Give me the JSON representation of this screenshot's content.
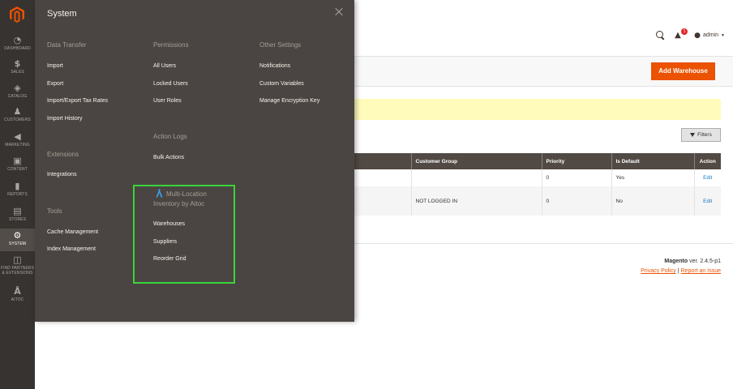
{
  "colors": {
    "sidebar_bg": "#373330",
    "flyout_bg": "#4a4542",
    "accent": "#eb5202",
    "highlight_border": "#39d53a",
    "grid_header": "#514943",
    "notice_bg": "#fffbbb",
    "link": "#1979c3"
  },
  "sidebar": {
    "logo_icon": "magento-logo-icon",
    "items": [
      {
        "label": "DASHBOARD",
        "icon": "speedometer-icon"
      },
      {
        "label": "SALES",
        "icon": "dollar-icon"
      },
      {
        "label": "CATALOG",
        "icon": "cube-icon"
      },
      {
        "label": "CUSTOMERS",
        "icon": "person-icon"
      },
      {
        "label": "MARKETING",
        "icon": "megaphone-icon"
      },
      {
        "label": "CONTENT",
        "icon": "layout-icon"
      },
      {
        "label": "REPORTS",
        "icon": "bar-chart-icon"
      },
      {
        "label": "STORES",
        "icon": "storefront-icon"
      },
      {
        "label": "SYSTEM",
        "icon": "gear-icon"
      },
      {
        "label": "FIND PARTNERS",
        "label2": "& EXTENSIONS",
        "icon": "blocks-icon"
      },
      {
        "label": "AITOC",
        "icon": "aitoc-logo-icon"
      }
    ]
  },
  "header": {
    "user": "admin",
    "notification_count": "1"
  },
  "page": {
    "add_button": "Add Warehouse",
    "filters_button": "Filters"
  },
  "grid": {
    "columns": [
      "Customer Group",
      "Priority",
      "Is Default",
      "Action"
    ],
    "rows": [
      {
        "customer_group": "",
        "priority": "0",
        "is_default": "Yes",
        "action": "Edit"
      },
      {
        "customer_group": "NOT LOGGED IN",
        "priority": "0",
        "is_default": "No",
        "action": "Edit"
      }
    ]
  },
  "footer": {
    "brand": "Magento",
    "version": " ver. 2.4.5-p1",
    "privacy": "Privacy Policy",
    "separator": "|",
    "report": "Report an Issue"
  },
  "flyout": {
    "title": "System",
    "sections": {
      "data_transfer": {
        "title": "Data Transfer",
        "items": [
          "Import",
          "Export",
          "Import/Export Tax Rates",
          "Import History"
        ]
      },
      "extensions": {
        "title": "Extensions",
        "items": [
          "Integrations"
        ]
      },
      "tools": {
        "title": "Tools",
        "items": [
          "Cache Management",
          "Index Management"
        ]
      },
      "permissions": {
        "title": "Permissions",
        "items": [
          "All Users",
          "Locked Users",
          "User Roles"
        ]
      },
      "action_logs": {
        "title": "Action Logs",
        "items": [
          "Bulk Actions"
        ]
      },
      "aitoc": {
        "title_line1": "Multi-Location",
        "title_line2": "Inventory by Aitoc",
        "items": [
          "Warehouses",
          "Suppliers",
          "Reorder Grid"
        ]
      },
      "other_settings": {
        "title": "Other Settings",
        "items": [
          "Notifications",
          "Custom Variables",
          "Manage Encryption Key"
        ]
      }
    }
  }
}
